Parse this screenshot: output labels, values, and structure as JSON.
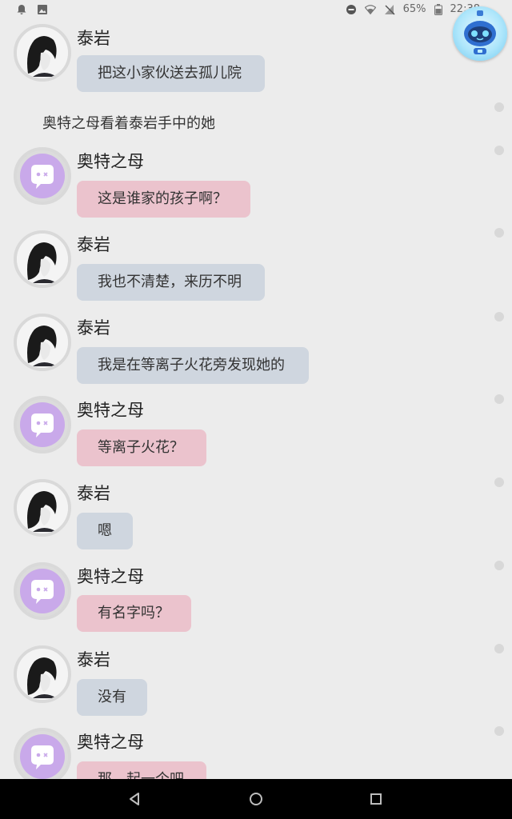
{
  "status_bar": {
    "battery": "65%",
    "time": "22:38"
  },
  "chat": {
    "messages": [
      {
        "speaker": "泰岩",
        "text": "把这小家伙送去孤儿院"
      },
      {
        "narration": "奥特之母看着泰岩手中的她"
      },
      {
        "speaker": "奥特之母",
        "text": "这是谁家的孩子啊？"
      },
      {
        "speaker": "泰岩",
        "text": "我也不清楚，来历不明"
      },
      {
        "speaker": "泰岩",
        "text": "我是在等离子火花旁发现她的"
      },
      {
        "speaker": "奥特之母",
        "text": "等离子火花？"
      },
      {
        "speaker": "泰岩",
        "text": "嗯"
      },
      {
        "speaker": "奥特之母",
        "text": "有名字吗？"
      },
      {
        "speaker": "泰岩",
        "text": "没有"
      },
      {
        "speaker": "奥特之母",
        "text": "那，起一个吧"
      }
    ]
  },
  "colors": {
    "background": "#ececec",
    "taiyan_bubble": "#cfd6df",
    "mother_bubble": "#ebc3cd",
    "mother_avatar": "#c9a9ea",
    "navbar": "#000000"
  },
  "icons": {
    "status_left": [
      "notification-icon",
      "image-icon"
    ],
    "status_right": [
      "do-not-disturb-icon",
      "wifi-icon",
      "no-sim-icon",
      "battery-icon"
    ],
    "nav": [
      "back-icon",
      "home-icon",
      "recents-icon"
    ]
  }
}
